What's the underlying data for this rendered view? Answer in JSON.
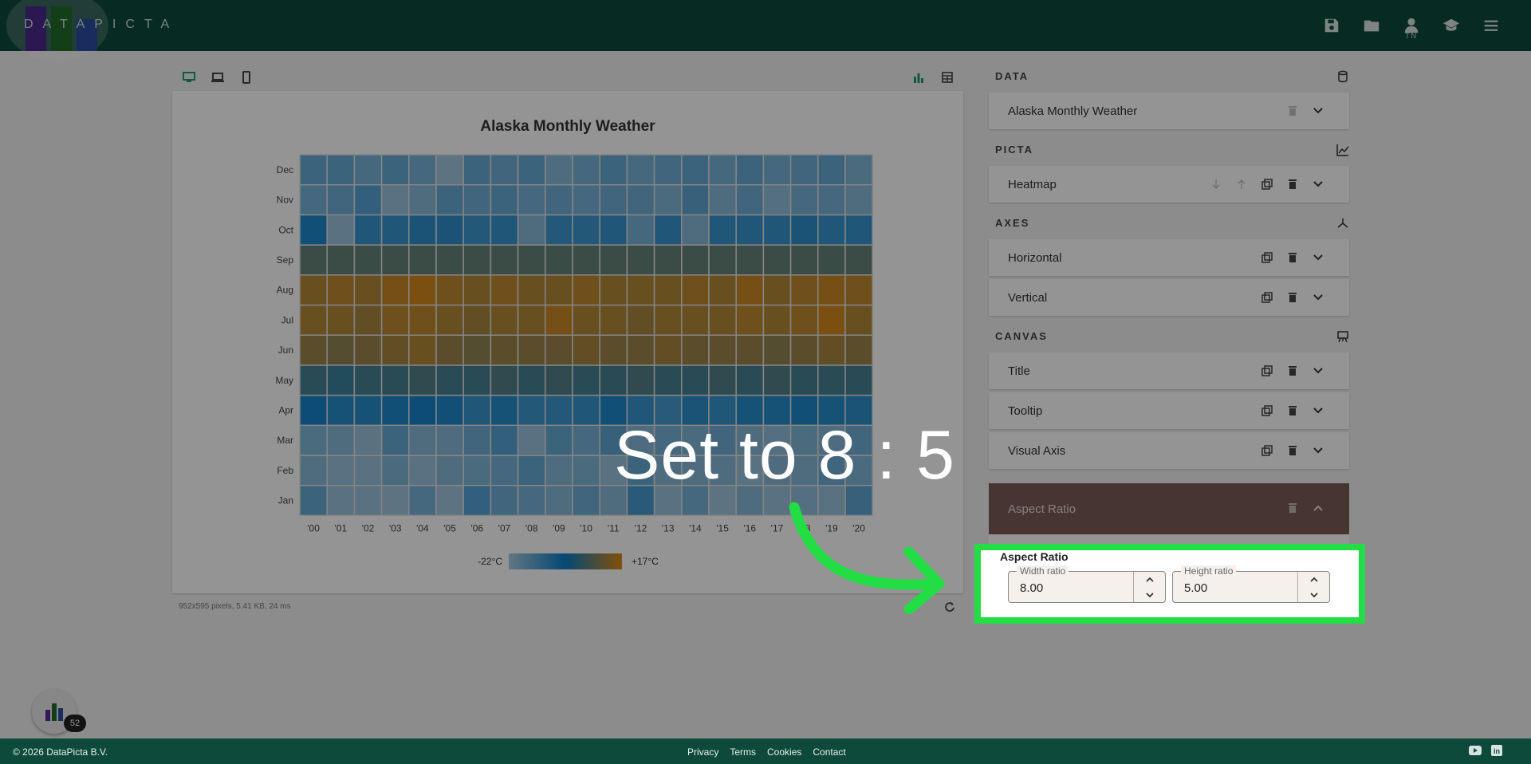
{
  "app": {
    "logo_text": "DATAPICTA",
    "user_initials": "TN"
  },
  "toolbar": {
    "device_icons": [
      "desktop-icon",
      "laptop-icon",
      "phone-icon"
    ],
    "view_icons": [
      "chart-icon",
      "table-icon"
    ]
  },
  "chart": {
    "title": "Alaska Monthly Weather",
    "meta": "952x595 pixels, 5.41 KB, 24 ms",
    "legend_min": "-22°C",
    "legend_max": "+17°C"
  },
  "chart_data": {
    "type": "heatmap",
    "title": "Alaska Monthly Weather",
    "x_categories": [
      "'00",
      "'01",
      "'02",
      "'03",
      "'04",
      "'05",
      "'06",
      "'07",
      "'08",
      "'09",
      "'10",
      "'11",
      "'12",
      "'13",
      "'14",
      "'15",
      "'16",
      "'17",
      "'18",
      "'19",
      "'20"
    ],
    "y_categories": [
      "Jan",
      "Feb",
      "Mar",
      "Apr",
      "May",
      "Jun",
      "Jul",
      "Aug",
      "Sep",
      "Oct",
      "Nov",
      "Dec"
    ],
    "color_scale": {
      "min": -22,
      "max": 17,
      "unit": "°C",
      "colors": [
        "#a9cbe0",
        "#0a7ec8",
        "#e08a12"
      ]
    },
    "values": [
      [
        -14,
        -20,
        -20,
        -21,
        -16,
        -21,
        -12,
        -15,
        -16,
        -18,
        -15,
        -18,
        -10,
        -20,
        -16,
        -21,
        -18,
        -20,
        -19,
        -20,
        -13
      ],
      [
        -18,
        -20,
        -20,
        -17,
        -20,
        -18,
        -17,
        -16,
        -14,
        -18,
        -17,
        -20,
        -14,
        -18,
        -18,
        -18,
        -20,
        -18,
        -18,
        -15,
        -17
      ],
      [
        -17,
        -18,
        -20,
        -14,
        -18,
        -18,
        -15,
        -12,
        -20,
        -14,
        -16,
        -13,
        -18,
        -16,
        -17,
        -15,
        -18,
        -19,
        -17,
        -18,
        -15
      ],
      [
        -4,
        -6,
        -6,
        -5,
        -4,
        -5,
        -8,
        -6,
        -9,
        -9,
        -8,
        -5,
        -8,
        -10,
        -7,
        -8,
        -6,
        -6,
        -5,
        -6,
        -7
      ],
      [
        3,
        2,
        3,
        3,
        4,
        3,
        3,
        4,
        3,
        4,
        3,
        3,
        4,
        3,
        3,
        4,
        3,
        4,
        3,
        3,
        3
      ],
      [
        11,
        10,
        11,
        12,
        13,
        11,
        10,
        11,
        11,
        11,
        12,
        11,
        11,
        12,
        11,
        11,
        11,
        10,
        11,
        12,
        11
      ],
      [
        13,
        13,
        12,
        14,
        14,
        13,
        12,
        13,
        13,
        15,
        13,
        13,
        12,
        13,
        13,
        13,
        14,
        13,
        14,
        16,
        13
      ],
      [
        13,
        14,
        13,
        15,
        16,
        14,
        13,
        14,
        13,
        13,
        14,
        13,
        13,
        13,
        14,
        13,
        15,
        13,
        14,
        15,
        14
      ],
      [
        6,
        6,
        6,
        6,
        6,
        6,
        6,
        6,
        6,
        6,
        6,
        6,
        6,
        6,
        6,
        6,
        6,
        6,
        6,
        6,
        6
      ],
      [
        -5,
        -20,
        -8,
        -8,
        -7,
        -7,
        -9,
        -8,
        -18,
        -9,
        -9,
        -8,
        -16,
        -8,
        -18,
        -8,
        -8,
        -8,
        -7,
        -8,
        -8
      ],
      [
        -16,
        -15,
        -12,
        -20,
        -18,
        -14,
        -15,
        -14,
        -16,
        -15,
        -16,
        -15,
        -15,
        -17,
        -13,
        -18,
        -15,
        -19,
        -16,
        -16,
        -18
      ],
      [
        -14,
        -14,
        -16,
        -14,
        -16,
        -21,
        -14,
        -15,
        -14,
        -18,
        -16,
        -14,
        -16,
        -15,
        -14,
        -16,
        -14,
        -16,
        -15,
        -14,
        -17
      ]
    ]
  },
  "panel": {
    "data_header": "DATA",
    "data_item": "Alaska Monthly Weather",
    "picta_header": "PICTA",
    "picta_item": "Heatmap",
    "axes_header": "AXES",
    "axes_items": [
      "Horizontal",
      "Vertical"
    ],
    "canvas_header": "CANVAS",
    "canvas_items": [
      "Title",
      "Tooltip",
      "Visual Axis"
    ],
    "aspect_header": "Aspect Ratio",
    "aspect_title": "Aspect Ratio",
    "width_label": "Width ratio",
    "width_value": "8.00",
    "height_label": "Height ratio",
    "height_value": "5.00"
  },
  "overlay": {
    "callout": "Set to 8 : 5"
  },
  "footer": {
    "copyright": "© 2026 DataPicta B.V.",
    "links": [
      "Privacy",
      "Terms",
      "Cookies",
      "Contact"
    ]
  },
  "fab": {
    "badge": "52"
  },
  "colors": {
    "topbar": "#0d4a3c",
    "accent": "#1a9a7a",
    "highlight": "#22dd44"
  }
}
